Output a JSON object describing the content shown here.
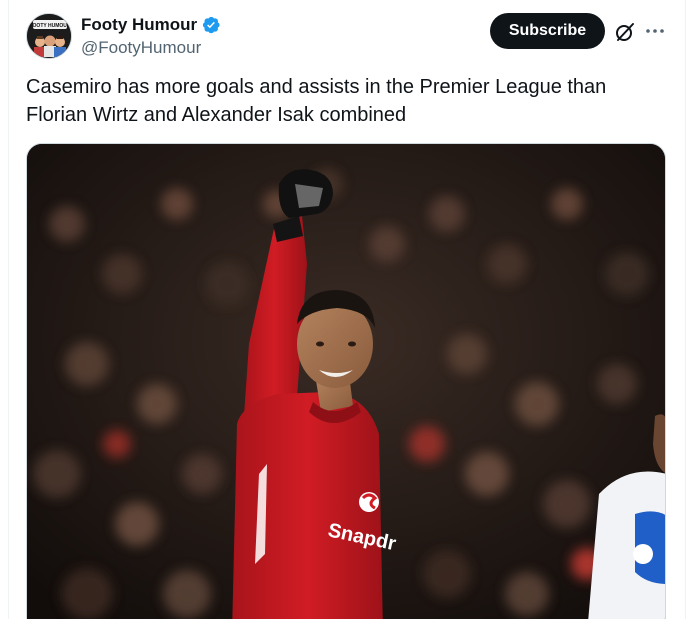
{
  "author": {
    "display_name": "Footy Humour",
    "handle": "@FootyHumour",
    "verified": true,
    "verified_badge_color": "#1d9bf0",
    "avatar_text": "FOOTY HUMOUR"
  },
  "actions": {
    "subscribe_label": "Subscribe",
    "grok_icon": "grok-icon",
    "more_icon": "more-options-icon"
  },
  "tweet": {
    "text": "Casemiro has more goals and assists in the Premier League than Florian Wirtz and Alexander Isak combined"
  },
  "media": {
    "kit_sponsor": "Snapdragon",
    "shirt_text": "Snapdr",
    "colors": {
      "kit_red": "#d11c24",
      "crowd_dark": "#1a1512",
      "opponent_blue": "#1f5fc7"
    }
  },
  "theme": {
    "text_primary": "#0f1419",
    "text_secondary": "#536471",
    "button_dark": "#0f1419"
  }
}
